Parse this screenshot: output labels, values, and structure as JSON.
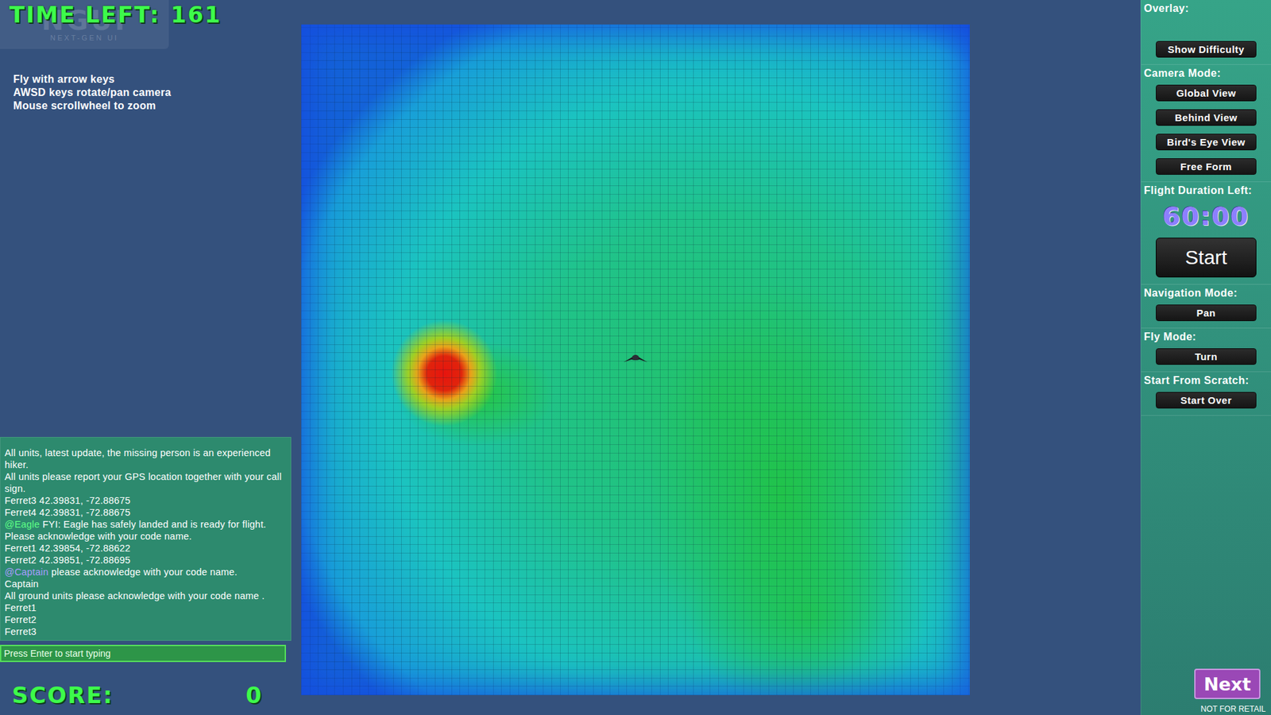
{
  "logo": {
    "mark": "NGUI",
    "subtitle": "NEXT-GEN UI"
  },
  "timer": {
    "label": "TIME LEFT:",
    "value": "161"
  },
  "instructions": [
    "Fly with arrow keys",
    "AWSD keys rotate/pan camera",
    "Mouse scrollwheel to zoom"
  ],
  "chat": {
    "messages": [
      {
        "mention": "",
        "text": "All units, latest update, the missing person is an experienced hiker.",
        "color": "#ffffff"
      },
      {
        "mention": "",
        "text": "All units please report your GPS location together with your call sign.",
        "color": "#ffffff"
      },
      {
        "mention": "",
        "text": "Ferret3 42.39831, -72.88675",
        "color": "#ffffff"
      },
      {
        "mention": "",
        "text": "Ferret4 42.39831, -72.88675",
        "color": "#ffffff"
      },
      {
        "mention": "@Eagle",
        "text": " FYI: Eagle has safely landed and is ready for flight. Please acknowledge with your code name.",
        "color": "#5dff86"
      },
      {
        "mention": "",
        "text": "Ferret1 42.39854, -72.88622",
        "color": "#ffffff"
      },
      {
        "mention": "",
        "text": "Ferret2 42.39851, -72.88695",
        "color": "#ffffff"
      },
      {
        "mention": "@Captain",
        "text": " please acknowledge with your code name.",
        "color": "#a99cff"
      },
      {
        "mention": "",
        "text": "Captain",
        "color": "#ffffff"
      },
      {
        "mention": "",
        "text": "All ground units please acknowledge with  your code name .",
        "color": "#ffffff"
      },
      {
        "mention": "",
        "text": "Ferret1",
        "color": "#ffffff"
      },
      {
        "mention": "",
        "text": "Ferret2",
        "color": "#ffffff"
      },
      {
        "mention": "",
        "text": "Ferret3",
        "color": "#ffffff"
      }
    ],
    "input_placeholder": "Press Enter to start typing"
  },
  "score": {
    "label": "SCORE:",
    "value": "0"
  },
  "side_panel": {
    "sections": [
      {
        "kind": "buttons",
        "label": "Overlay:",
        "buttons": [
          {
            "label": "Show Difficulty",
            "selected": false
          }
        ]
      },
      {
        "kind": "buttons",
        "label": "Camera Mode:",
        "buttons": [
          {
            "label": "Global View",
            "selected": false
          },
          {
            "label": "Behind View",
            "selected": false
          },
          {
            "label": "Bird's Eye View",
            "selected": false
          },
          {
            "label": "Free Form",
            "selected": false
          }
        ]
      },
      {
        "kind": "timer",
        "label": "Flight Duration Left:",
        "value": "60:00",
        "buttons": [
          {
            "label": "Start",
            "selected": false
          }
        ]
      },
      {
        "kind": "buttons",
        "label": "Navigation Mode:",
        "buttons": [
          {
            "label": "Pan",
            "selected": false
          }
        ]
      },
      {
        "kind": "buttons",
        "label": "Fly Mode:",
        "buttons": [
          {
            "label": "Turn",
            "selected": false
          }
        ]
      },
      {
        "kind": "buttons",
        "label": "Start From Scratch:",
        "buttons": [
          {
            "label": "Start Over",
            "selected": false
          }
        ]
      }
    ],
    "next": "Next",
    "footer": "NOT FOR RETAIL"
  }
}
